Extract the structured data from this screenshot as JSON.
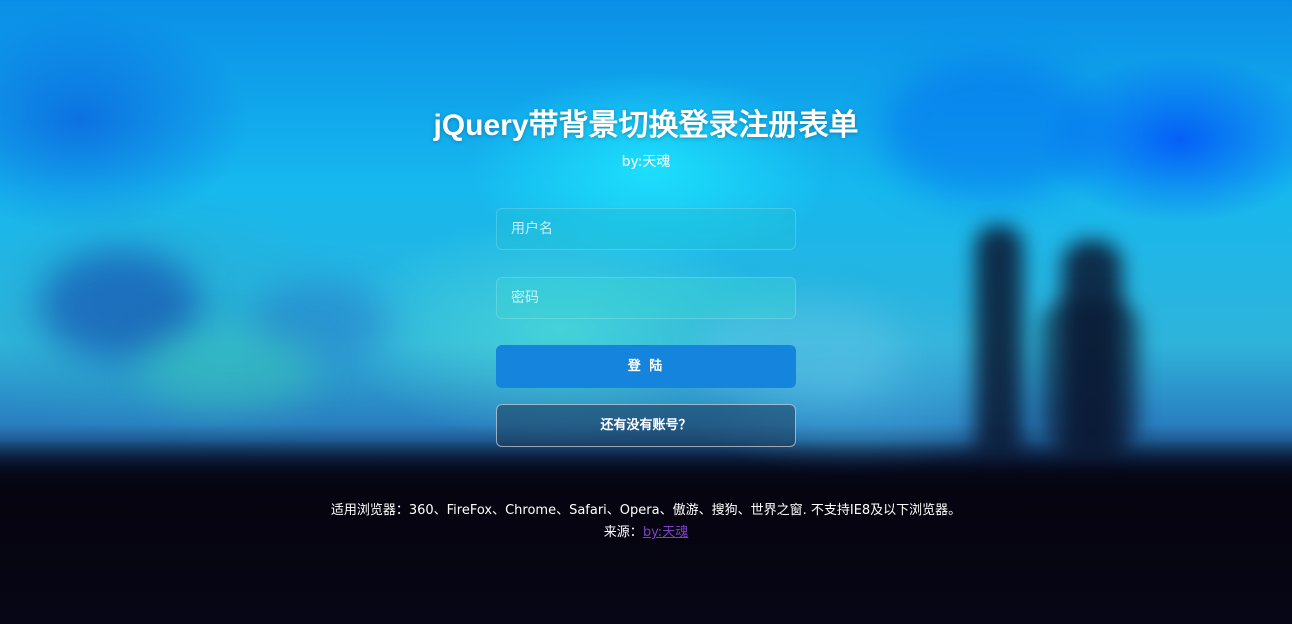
{
  "header": {
    "title": "jQuery带背景切换登录注册表单",
    "subtitle": "by:天魂"
  },
  "form": {
    "username_placeholder": "用户名",
    "username_value": "",
    "password_placeholder": "密码",
    "password_value": "",
    "login_label": "登 陆",
    "register_label": "还有没有账号？"
  },
  "footer": {
    "browsers_text": "适用浏览器：360、FireFox、Chrome、Safari、Opera、傲游、搜狗、世界之窗. 不支持IE8及以下浏览器。",
    "source_label": "来源：",
    "source_link": "by:天魂"
  },
  "colors": {
    "login_button": "#1584dc",
    "link": "#7d3fc8",
    "background_top": "#0a8fe8",
    "background_bottom": "#05040f"
  }
}
